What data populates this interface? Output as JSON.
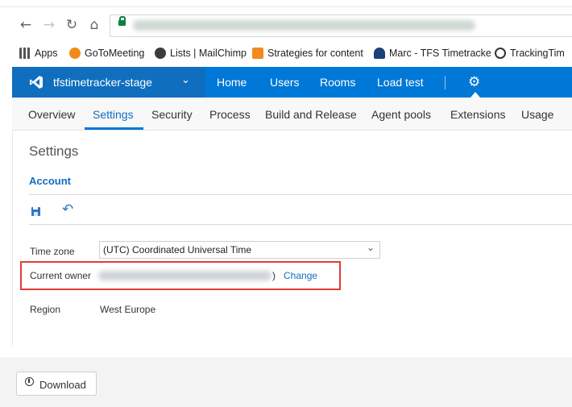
{
  "browser": {
    "bookmarks": [
      "Apps",
      "GoToMeeting",
      "Lists | MailChimp",
      "Strategies for content",
      "Marc - TFS Timetracke",
      "TrackingTim"
    ]
  },
  "header": {
    "account_name": "tfstimetracker-stage",
    "nav": [
      "Home",
      "Users",
      "Rooms",
      "Load test"
    ]
  },
  "tabs": [
    "Overview",
    "Settings",
    "Security",
    "Process",
    "Build and Release",
    "Agent pools",
    "Extensions",
    "Usage"
  ],
  "tabs_active": "Settings",
  "page": {
    "title": "Settings",
    "section": "Account",
    "time_zone_label": "Time zone",
    "time_zone_value": "(UTC) Coordinated Universal Time",
    "owner_label": "Current owner",
    "owner_suffix": ")",
    "change_label": "Change",
    "region_label": "Region",
    "region_value": "West Europe"
  },
  "footer": {
    "download_label": "Download"
  },
  "colors": {
    "accent": "#0078d7",
    "accent_dark": "#106ebe",
    "highlight": "#e23b3b"
  },
  "icons": [
    "back-arrow-icon",
    "forward-arrow-icon",
    "reload-icon",
    "home-icon",
    "lock-icon",
    "vs-logo-icon",
    "chevron-down-icon",
    "gear-icon",
    "save-icon",
    "undo-icon",
    "download-icon"
  ]
}
